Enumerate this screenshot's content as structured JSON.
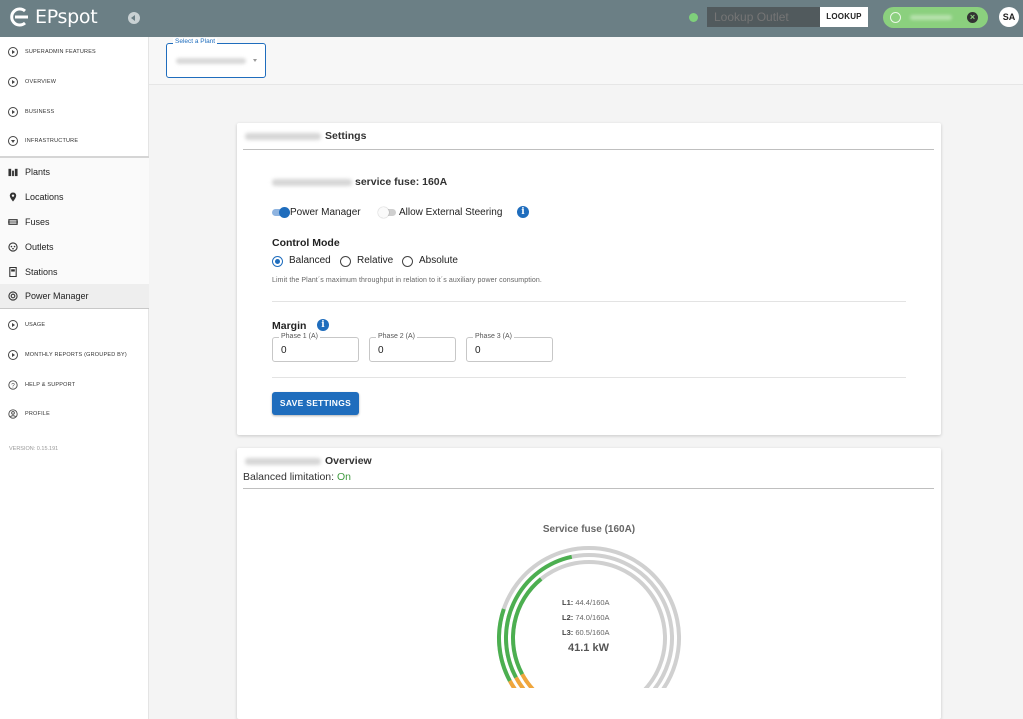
{
  "app": {
    "name": "EPspot"
  },
  "topbar": {
    "lookup_placeholder": "Lookup Outlet",
    "lookup_button": "LOOKUP",
    "user_initials": "SA"
  },
  "sidebar": {
    "sections_top": [
      {
        "label": "SUPERADMIN FEATURES",
        "icon": "chevron-circle-icon"
      },
      {
        "label": "OVERVIEW",
        "icon": "chevron-circle-icon"
      },
      {
        "label": "BUSINESS",
        "icon": "chevron-circle-icon"
      },
      {
        "label": "INFRASTRUCTURE",
        "icon": "chevron-circle-icon"
      }
    ],
    "items": [
      {
        "label": "Plants",
        "icon": "plant-icon"
      },
      {
        "label": "Locations",
        "icon": "location-pin-icon"
      },
      {
        "label": "Fuses",
        "icon": "fuse-icon"
      },
      {
        "label": "Outlets",
        "icon": "outlet-icon"
      },
      {
        "label": "Stations",
        "icon": "station-icon"
      },
      {
        "label": "Power Manager",
        "icon": "power-manager-icon",
        "active": true
      }
    ],
    "sections_bottom": [
      {
        "label": "USAGE",
        "icon": "chevron-circle-icon"
      },
      {
        "label": "MONTHLY REPORTS (GROUPED BY)",
        "icon": "chevron-circle-icon"
      },
      {
        "label": "HELP & SUPPORT",
        "icon": "help-icon"
      },
      {
        "label": "PROFILE",
        "icon": "profile-icon"
      }
    ],
    "version": "VERSION: 0.15.191"
  },
  "plant_select": {
    "legend": "Select a Plant"
  },
  "settings": {
    "title": "Settings",
    "fuse_label": "service fuse: 160A",
    "power_manager_label": "Power Manager",
    "power_manager_on": true,
    "external_steering_label": "Allow External Steering",
    "external_steering_on": false,
    "control_mode": {
      "label": "Control Mode",
      "options": [
        "Balanced",
        "Relative",
        "Absolute"
      ],
      "selected": "Balanced",
      "hint": "Limit the Plant´s maximum throughput in relation to it´s auxiliary power consumption."
    },
    "margin": {
      "label": "Margin",
      "phases": [
        {
          "label": "Phase 1 (A)",
          "value": "0"
        },
        {
          "label": "Phase 2 (A)",
          "value": "0"
        },
        {
          "label": "Phase 3 (A)",
          "value": "0"
        }
      ]
    },
    "save_button": "SAVE SETTINGS"
  },
  "overview": {
    "title": "Overview",
    "balanced_label": "Balanced limitation:",
    "balanced_value": "On",
    "gauge": {
      "title": "Service fuse (160A)",
      "lines": [
        {
          "key": "L1:",
          "value": "44.4/160A",
          "current": 44.4
        },
        {
          "key": "L2:",
          "value": "74.0/160A",
          "current": 74.0
        },
        {
          "key": "L3:",
          "value": "60.5/160A",
          "current": 60.5
        }
      ],
      "max": 160,
      "total": "41.1 kW",
      "colors": {
        "track": "#d0d0d0",
        "ok": "#4caf50",
        "warn": "#f0a63c"
      }
    }
  }
}
